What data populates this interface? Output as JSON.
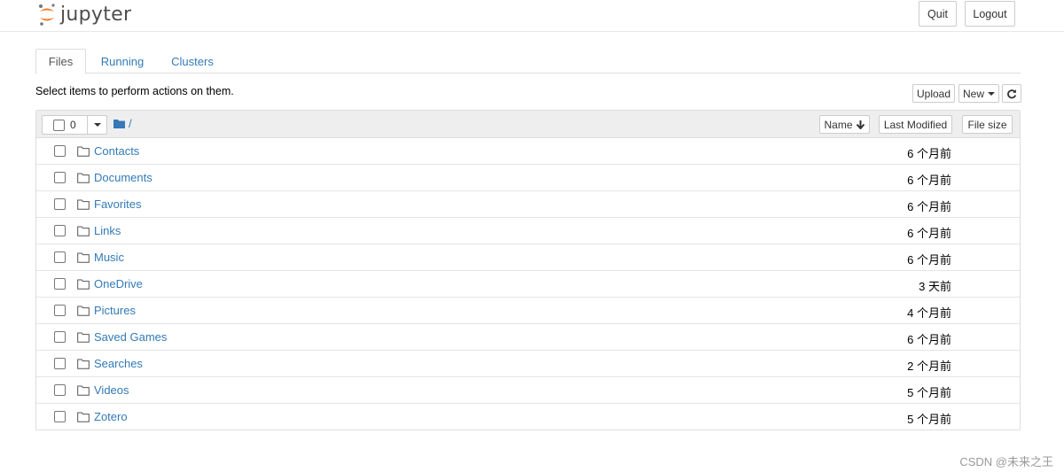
{
  "header": {
    "logo_text": "jupyter",
    "quit_label": "Quit",
    "logout_label": "Logout",
    "colors": {
      "logo_orange": "#f37726",
      "logo_gray": "#767677"
    }
  },
  "tabs": [
    {
      "label": "Files",
      "active": true
    },
    {
      "label": "Running",
      "active": false
    },
    {
      "label": "Clusters",
      "active": false
    }
  ],
  "toolbar": {
    "instructions": "Select items to perform actions on them.",
    "upload_label": "Upload",
    "new_label": "New",
    "refresh_icon": "refresh-icon"
  },
  "list_header": {
    "selected_count": "0",
    "path": "/",
    "sort_name_label": "Name",
    "sort_modified_label": "Last Modified",
    "sort_size_label": "File size"
  },
  "files": [
    {
      "name": "Contacts",
      "modified": "6 个月前"
    },
    {
      "name": "Documents",
      "modified": "6 个月前"
    },
    {
      "name": "Favorites",
      "modified": "6 个月前"
    },
    {
      "name": "Links",
      "modified": "6 个月前"
    },
    {
      "name": "Music",
      "modified": "6 个月前"
    },
    {
      "name": "OneDrive",
      "modified": "3 天前"
    },
    {
      "name": "Pictures",
      "modified": "4 个月前"
    },
    {
      "name": "Saved Games",
      "modified": "6 个月前"
    },
    {
      "name": "Searches",
      "modified": "2 个月前"
    },
    {
      "name": "Videos",
      "modified": "5 个月前"
    },
    {
      "name": "Zotero",
      "modified": "5 个月前"
    }
  ],
  "watermark": "CSDN @未来之王",
  "colors": {
    "link": "#337ab7",
    "header_bg": "#eeeeee",
    "border": "#dddddd"
  }
}
